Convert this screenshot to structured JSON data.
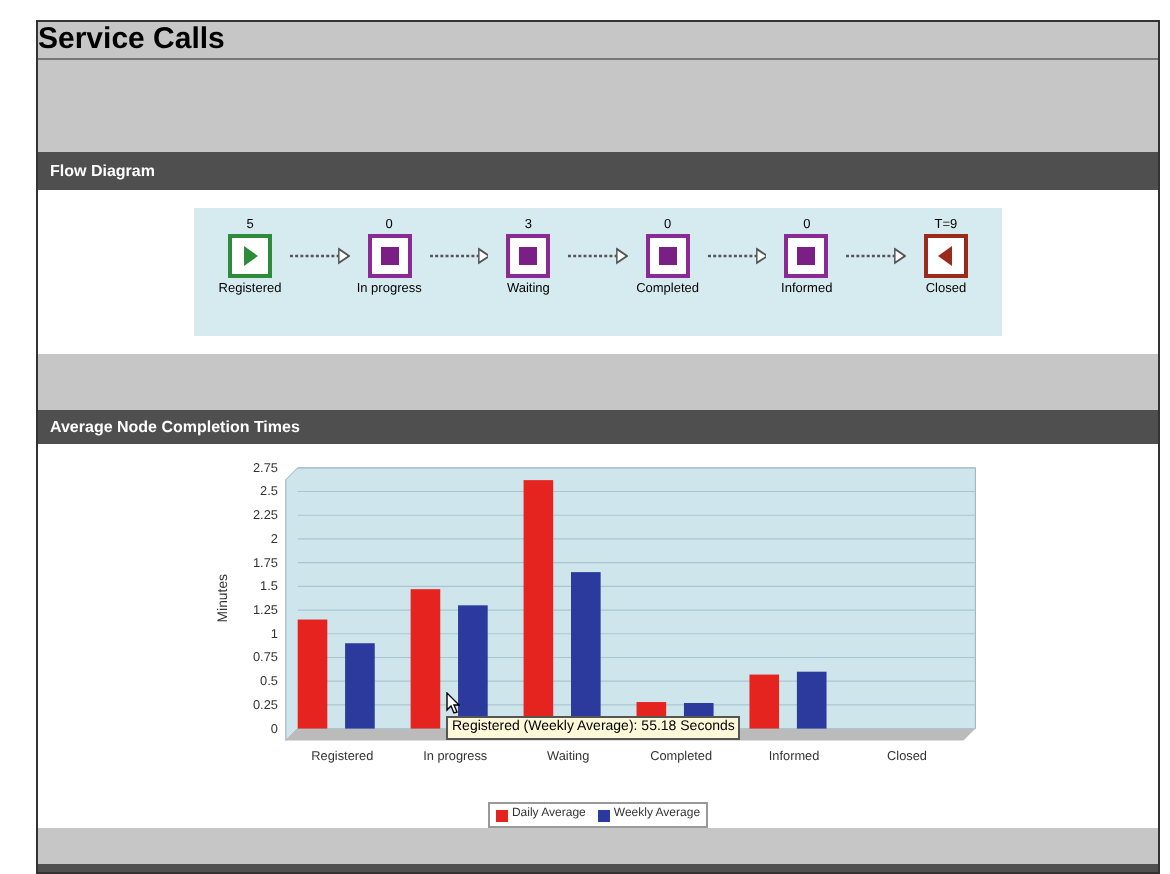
{
  "title": "Service Calls",
  "flow": {
    "header": "Flow Diagram",
    "nodes": [
      {
        "kind": "start",
        "label": "Registered",
        "count": "5"
      },
      {
        "kind": "step",
        "label": "In progress",
        "count": "0"
      },
      {
        "kind": "step",
        "label": "Waiting",
        "count": "3"
      },
      {
        "kind": "step",
        "label": "Completed",
        "count": "0"
      },
      {
        "kind": "step",
        "label": "Informed",
        "count": "0"
      },
      {
        "kind": "end",
        "label": "Closed",
        "count": "T=9"
      }
    ]
  },
  "completion": {
    "header": "Average Node Completion Times",
    "tooltip": "Registered (Weekly Average): 55.18 Seconds",
    "chart_data": {
      "type": "bar",
      "ylabel": "Minutes",
      "categories": [
        "Registered",
        "In progress",
        "Waiting",
        "Completed",
        "Informed",
        "Closed"
      ],
      "series": [
        {
          "name": "Daily Average",
          "color": "#e52420",
          "values": [
            1.15,
            1.47,
            2.62,
            0.28,
            0.57,
            0
          ]
        },
        {
          "name": "Weekly Average",
          "color": "#2b3a9c",
          "values": [
            0.9,
            1.3,
            1.65,
            0.27,
            0.6,
            0
          ]
        }
      ],
      "grid": true,
      "ylim": [
        0,
        2.75
      ],
      "yticks": [
        0,
        0.25,
        0.5,
        0.75,
        1,
        1.25,
        1.5,
        1.75,
        2,
        2.25,
        2.5,
        2.75
      ]
    }
  }
}
